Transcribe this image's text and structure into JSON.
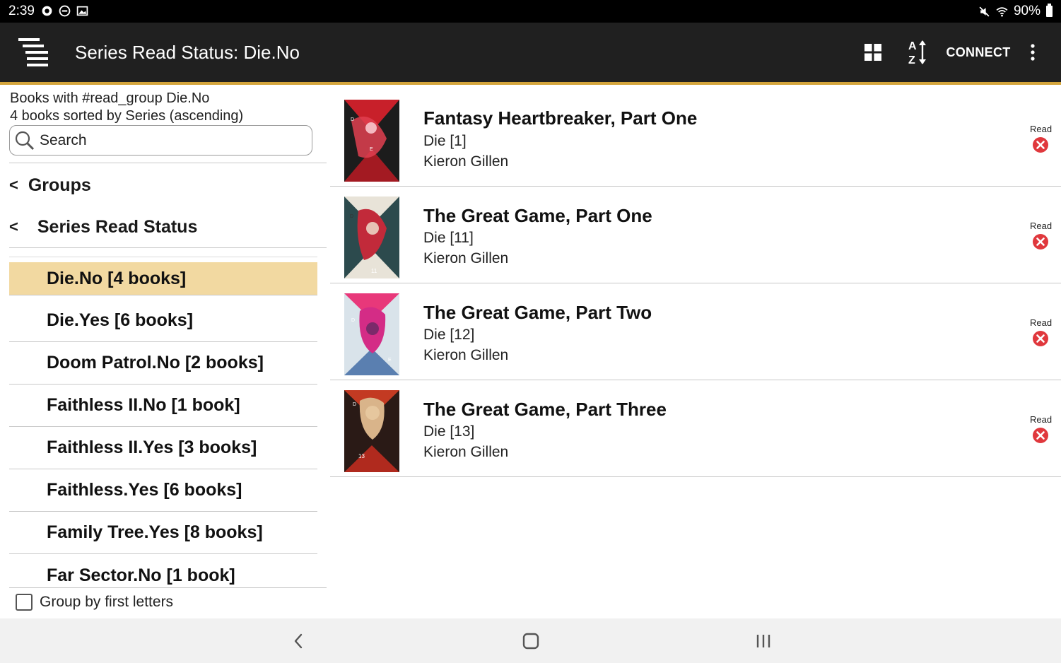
{
  "status_bar": {
    "time": "2:39",
    "battery": "90%",
    "left_icons": [
      "chat-bubble-icon",
      "do-not-disturb-icon",
      "image-icon"
    ],
    "right_icons": [
      "mute-icon",
      "wifi-icon",
      "battery-icon"
    ]
  },
  "app_bar": {
    "title": "Series Read Status: Die.No",
    "connect_label": "CONNECT",
    "background": "#202020",
    "accent": "#d4a53c"
  },
  "left_pane": {
    "info_line1": "Books with #read_group Die.No",
    "info_line2": "4 books sorted by Series (ascending)",
    "search_placeholder": "Search",
    "nav": [
      {
        "chevron": "<",
        "label": "Groups"
      },
      {
        "chevron": "<",
        "label": "Series Read Status"
      }
    ],
    "groups": [
      {
        "label": "Die.No [4 books]",
        "selected": true
      },
      {
        "label": "Die.Yes [6 books]",
        "selected": false
      },
      {
        "label": "Doom Patrol.No [2 books]",
        "selected": false
      },
      {
        "label": "Faithless II.No [1 book]",
        "selected": false
      },
      {
        "label": "Faithless II.Yes [3 books]",
        "selected": false
      },
      {
        "label": "Faithless.Yes [6 books]",
        "selected": false
      },
      {
        "label": "Family Tree.Yes [8 books]",
        "selected": false
      },
      {
        "label": "Far Sector.No [1 book]",
        "selected": false
      }
    ],
    "group_by_first_letters": {
      "label": "Group by first letters",
      "checked": false
    },
    "selected_color": "#f2d9a1"
  },
  "books": [
    {
      "title": "Fantasy Heartbreaker, Part One",
      "series": "Die [1]",
      "author": "Kieron Gillen",
      "read_label": "Read",
      "read": false
    },
    {
      "title": "The Great Game, Part One",
      "series": "Die [11]",
      "author": "Kieron Gillen",
      "read_label": "Read",
      "read": false
    },
    {
      "title": "The Great Game, Part Two",
      "series": "Die [12]",
      "author": "Kieron Gillen",
      "read_label": "Read",
      "read": false
    },
    {
      "title": "The Great Game, Part Three",
      "series": "Die [13]",
      "author": "Kieron Gillen",
      "read_label": "Read",
      "read": false
    }
  ],
  "nav_bar": {
    "buttons": [
      "back-icon",
      "home-icon",
      "recents-icon"
    ]
  }
}
